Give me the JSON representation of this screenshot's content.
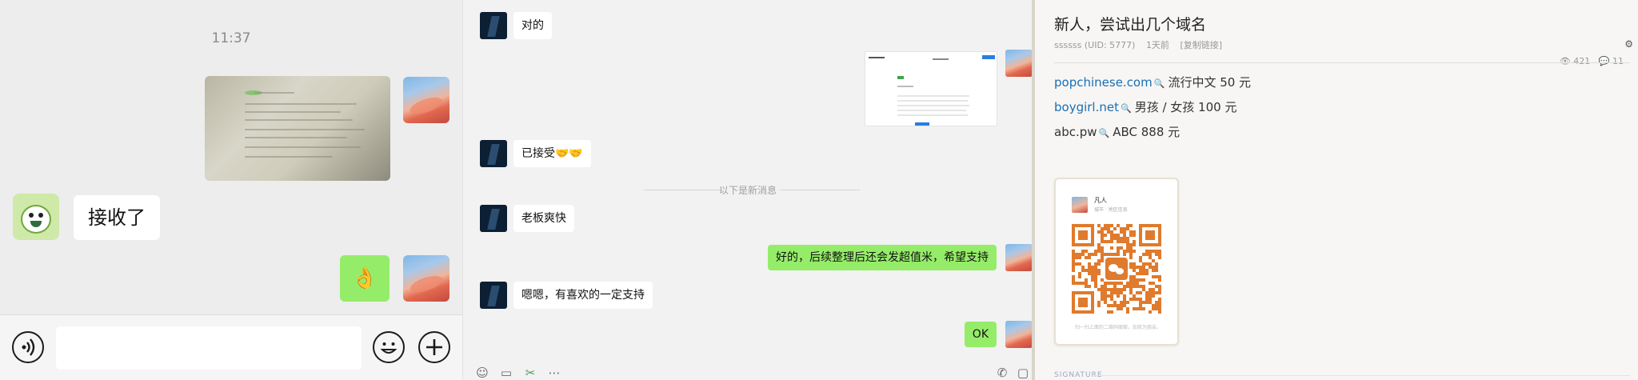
{
  "left_chat": {
    "time": "11:37",
    "received_text": "接收了",
    "ok_emoji": "👌"
  },
  "mid_chat": {
    "messages": [
      {
        "text": "对的"
      },
      {
        "text": "已接受🤝🤝"
      },
      {
        "text": "老板爽快"
      },
      {
        "text": "好的，后续整理后还会发超值米，希望支持"
      },
      {
        "text": "嗯嗯，有喜欢的一定支持"
      },
      {
        "text": "OK"
      }
    ],
    "divider": "以下是新消息"
  },
  "forum_post": {
    "title": "新人，尝试出几个域名",
    "author": "ssssss (UID: 5777)",
    "age": "1天前",
    "copy_link": "[复制链接]",
    "views": "421",
    "replies": "11",
    "domains": [
      {
        "name": "popchinese.com",
        "desc": "流行中文 50 元"
      },
      {
        "name": "boygirl.net",
        "desc": "男孩 / 女孩 100 元"
      },
      {
        "name": "abc.pw",
        "desc": "ABC 888 元"
      }
    ],
    "qr_card": {
      "name": "凡人",
      "subtitle": "城市 · 地区信息",
      "footer": "扫一扫上面的二维码图案，加我为朋友。"
    },
    "signature": "SIGNATURE"
  },
  "colors": {
    "bubble_green": "#95ec69",
    "link_blue": "#1a6fb5",
    "qr_orange": "#e07a2c"
  }
}
